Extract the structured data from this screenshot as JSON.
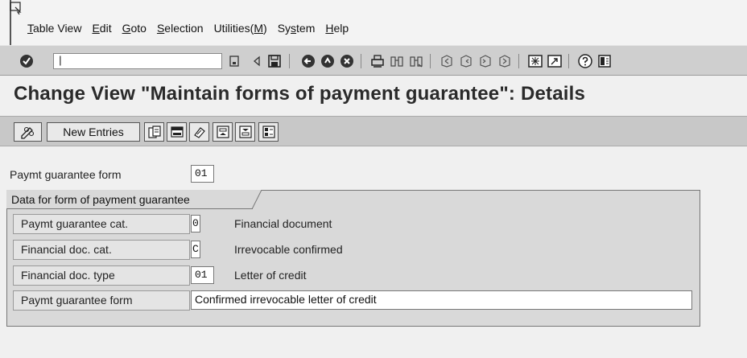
{
  "menu": {
    "items": [
      {
        "pre": "",
        "u": "T",
        "post": "able View"
      },
      {
        "pre": "",
        "u": "E",
        "post": "dit"
      },
      {
        "pre": "",
        "u": "G",
        "post": "oto"
      },
      {
        "pre": "",
        "u": "S",
        "post": "election"
      },
      {
        "pre": "Utilities(",
        "u": "M",
        "post": ")"
      },
      {
        "pre": "Sy",
        "u": "s",
        "post": "tem"
      },
      {
        "pre": "",
        "u": "H",
        "post": "elp"
      }
    ]
  },
  "toolbar": {
    "command_value": "|",
    "icons": [
      "enter-icon",
      "save-icon",
      "back-icon",
      "exit-icon",
      "cancel-icon",
      "print-icon",
      "find-icon",
      "find-next-icon",
      "first-page-icon",
      "previous-page-icon",
      "next-page-icon",
      "last-page-icon",
      "create-session-icon",
      "shortcut-icon",
      "help-icon",
      "layout-icon"
    ]
  },
  "title": "Change View \"Maintain forms of payment guarantee\": Details",
  "app_toolbar": {
    "new_entries_label": "New Entries"
  },
  "header": {
    "label": "Paymt guarantee form",
    "value": "01"
  },
  "group": {
    "title": "Data for form of payment guarantee",
    "rows": [
      {
        "label": "Paymt guarantee cat.",
        "value": "0",
        "desc": "Financial document"
      },
      {
        "label": "Financial doc. cat.",
        "value": "C",
        "desc": "Irrevocable confirmed"
      },
      {
        "label": "Financial doc. type",
        "value": "01",
        "desc": "Letter of credit"
      },
      {
        "label": "Paymt guarantee form",
        "value": "Confirmed irrevocable letter of credit"
      }
    ]
  }
}
